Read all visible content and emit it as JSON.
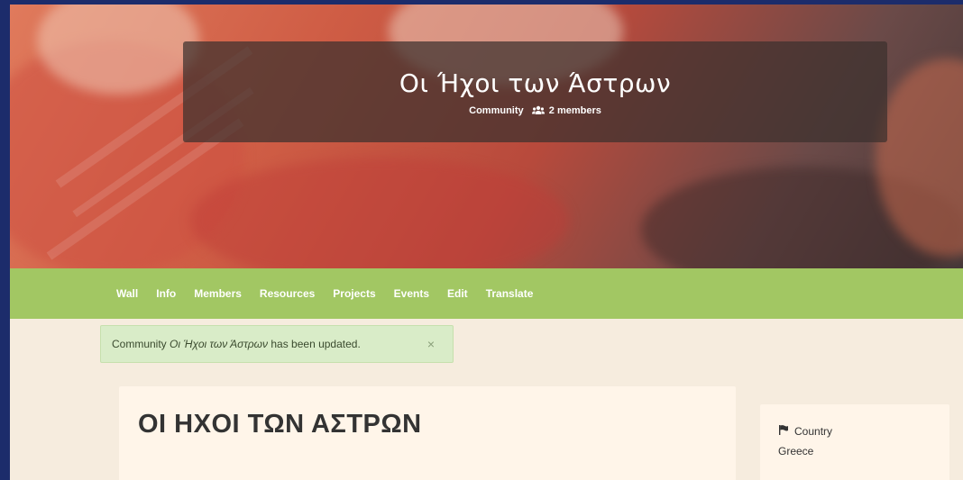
{
  "hero": {
    "title": "Οι Ήχοι των Άστρων",
    "type_label": "Community",
    "members_label": "2 members"
  },
  "nav": {
    "items": [
      "Wall",
      "Info",
      "Members",
      "Resources",
      "Projects",
      "Events",
      "Edit",
      "Translate"
    ]
  },
  "alert": {
    "prefix": "Community ",
    "name": "Οι Ήχοι των Άστρων",
    "suffix": " has been updated.",
    "close": "×"
  },
  "main": {
    "heading": "ΟΙ ΗΧΟΙ ΤΩΝ ΑΣΤΡΩΝ"
  },
  "sidebar": {
    "country_label": "Country",
    "country_value": "Greece"
  },
  "colors": {
    "nav_bg": "#a2c763",
    "alert_bg": "#d9ecc8",
    "page_bg": "#f6ecde",
    "card_bg": "#fff5e9"
  }
}
